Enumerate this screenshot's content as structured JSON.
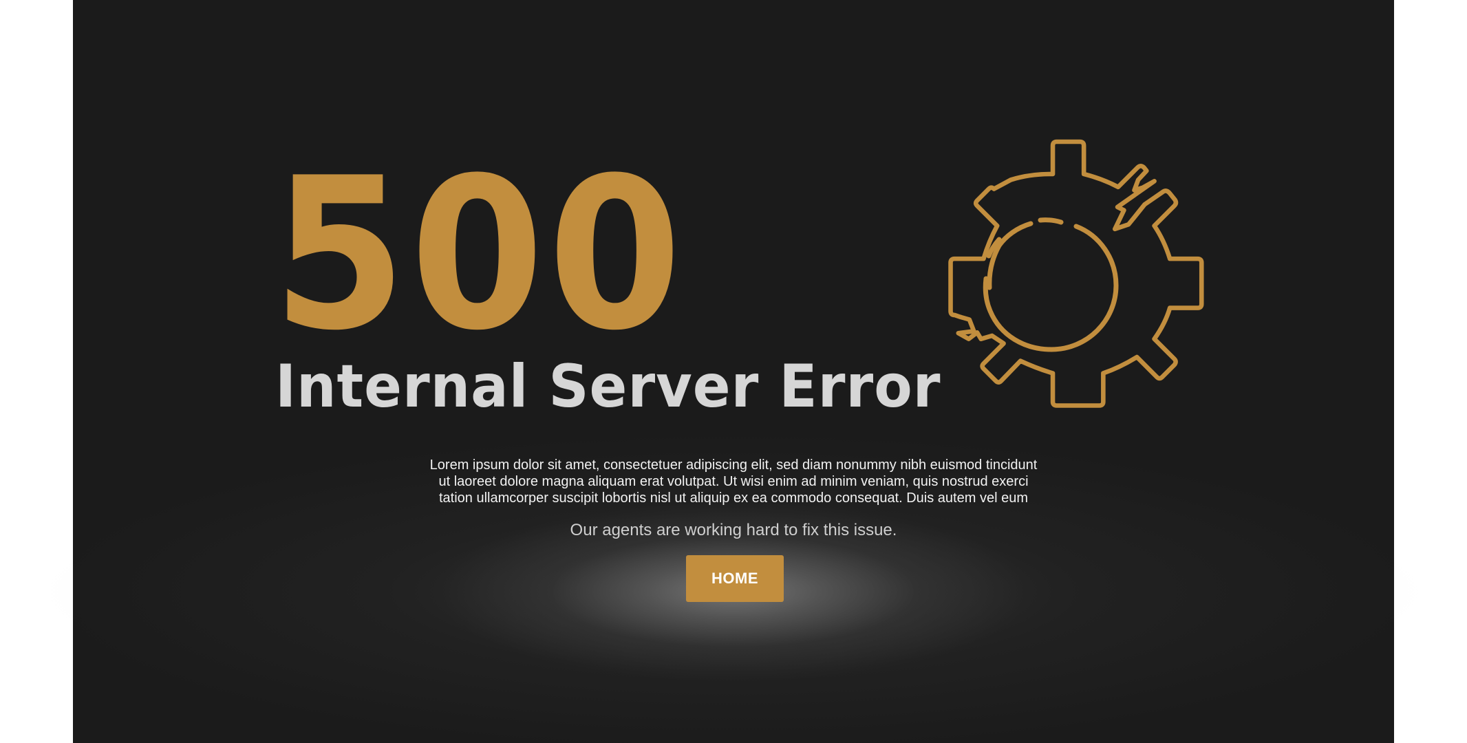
{
  "error": {
    "code": "500",
    "title": "Internal Server Error",
    "description_lines": [
      "Lorem ipsum dolor sit amet, consectetuer adipiscing elit, sed diam nonummy nibh euismod tincidunt",
      "ut laoreet dolore magna aliquam erat volutpat. Ut wisi enim ad minim veniam, quis nostrud exerci",
      "tation ullamcorper suscipit lobortis nisl ut aliquip ex ea commodo consequat. Duis autem vel eum"
    ],
    "status_message": "Our agents are working hard to fix this issue."
  },
  "actions": {
    "home_label": "HOME"
  },
  "icons": {
    "illustration": "broken-gear-icon"
  },
  "colors": {
    "accent": "#c28e3e",
    "background": "#1b1b1b",
    "subtitle_text": "#d6d6d6",
    "body_text": "#f2f2f2"
  }
}
